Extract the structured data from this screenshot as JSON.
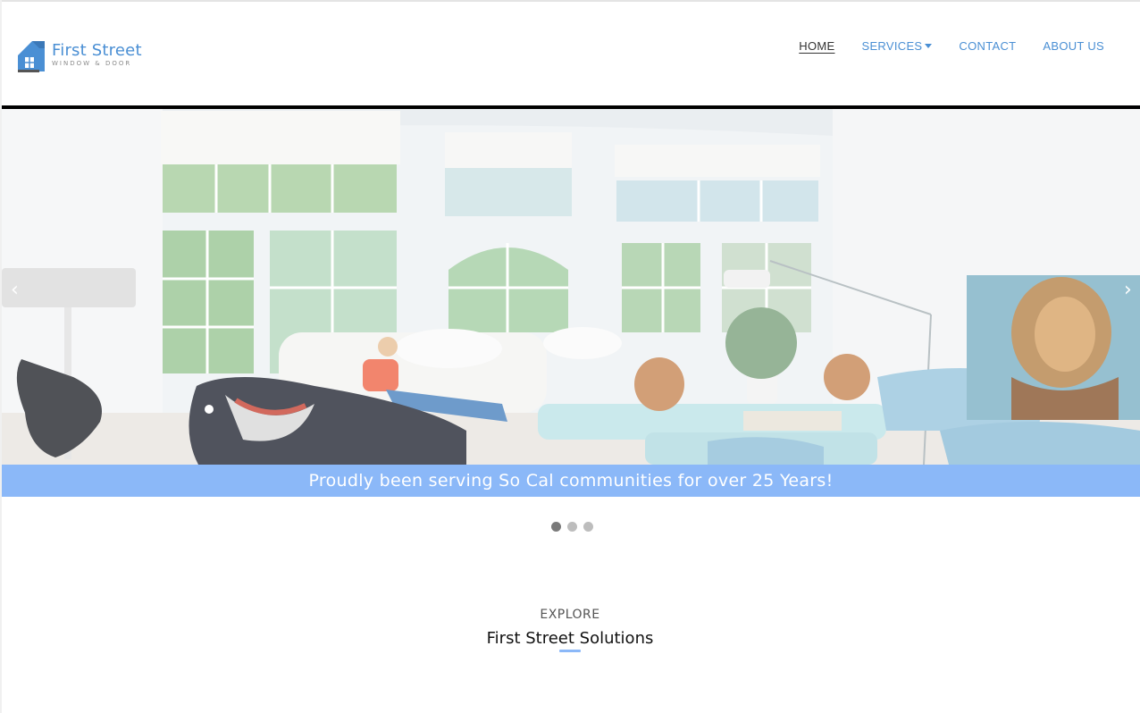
{
  "header": {
    "logo": {
      "name": "First Street",
      "tagline": "WINDOW & DOOR",
      "icon": "house-logo-icon"
    },
    "nav": {
      "items": [
        {
          "label": "HOME",
          "active": true
        },
        {
          "label": "SERVICES",
          "has_dropdown": true
        },
        {
          "label": "CONTACT"
        },
        {
          "label": "ABOUT US"
        }
      ]
    }
  },
  "hero": {
    "prev_label": "‹",
    "next_label": "›",
    "caption": "Proudly been serving So Cal communities for over 25 Years!",
    "slide_count": 3,
    "active_slide": 1
  },
  "explore": {
    "kicker": "EXPLORE",
    "title": "First Street Solutions"
  },
  "colors": {
    "brand_blue": "#4a8fd4",
    "caption_blue": "#8bb8f8",
    "nav_active": "#333333"
  }
}
